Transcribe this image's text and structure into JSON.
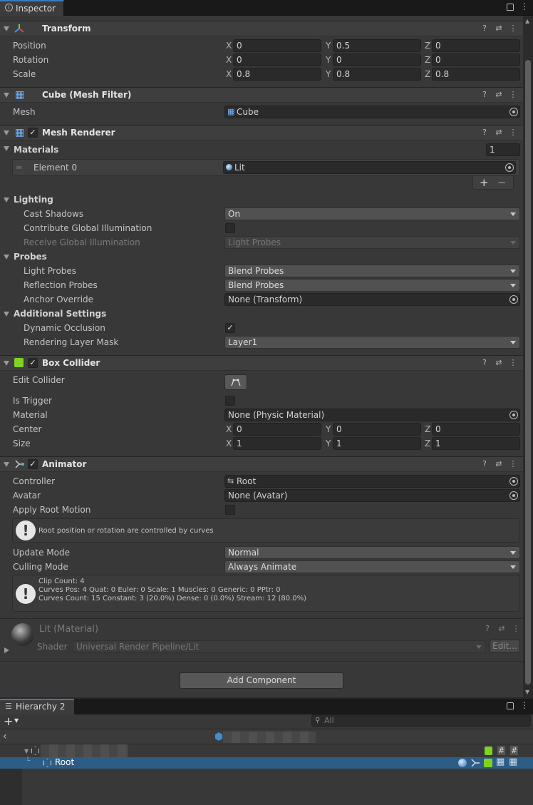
{
  "inspector_tab": {
    "title": "Inspector"
  },
  "transform": {
    "title": "Transform",
    "position": {
      "label": "Position",
      "x": "0",
      "y": "0.5",
      "z": "0"
    },
    "rotation": {
      "label": "Rotation",
      "x": "0",
      "y": "0",
      "z": "0"
    },
    "scale": {
      "label": "Scale",
      "x": "0.8",
      "y": "0.8",
      "z": "0.8"
    }
  },
  "axes": {
    "x": "X",
    "y": "Y",
    "z": "Z"
  },
  "mesh_filter": {
    "title": "Cube (Mesh Filter)",
    "mesh_label": "Mesh",
    "mesh_value": "Cube"
  },
  "mesh_renderer": {
    "title": "Mesh Renderer",
    "materials_label": "Materials",
    "materials_count": "1",
    "element0_label": "Element 0",
    "element0_value": "Lit",
    "add": "+",
    "remove": "−",
    "lighting_label": "Lighting",
    "cast_shadows_label": "Cast Shadows",
    "cast_shadows_value": "On",
    "contribute_gi_label": "Contribute Global Illumination",
    "receive_gi_label": "Receive Global Illumination",
    "receive_gi_value": "Light Probes",
    "probes_label": "Probes",
    "light_probes_label": "Light Probes",
    "light_probes_value": "Blend Probes",
    "reflection_probes_label": "Reflection Probes",
    "reflection_probes_value": "Blend Probes",
    "anchor_override_label": "Anchor Override",
    "anchor_override_value": "None (Transform)",
    "additional_label": "Additional Settings",
    "dynamic_occlusion_label": "Dynamic Occlusion",
    "rendering_layer_label": "Rendering Layer Mask",
    "rendering_layer_value": "Layer1"
  },
  "box_collider": {
    "title": "Box Collider",
    "edit_collider_label": "Edit Collider",
    "is_trigger_label": "Is Trigger",
    "material_label": "Material",
    "material_value": "None (Physic Material)",
    "center": {
      "label": "Center",
      "x": "0",
      "y": "0",
      "z": "0"
    },
    "size": {
      "label": "Size",
      "x": "1",
      "y": "1",
      "z": "1"
    }
  },
  "animator": {
    "title": "Animator",
    "controller_label": "Controller",
    "controller_value": "Root",
    "avatar_label": "Avatar",
    "avatar_value": "None (Avatar)",
    "apply_root_motion_label": "Apply Root Motion",
    "root_msg": "Root position or rotation are controlled by curves",
    "update_mode_label": "Update Mode",
    "update_mode_value": "Normal",
    "culling_mode_label": "Culling Mode",
    "culling_mode_value": "Always Animate",
    "clip_info_1": "Clip Count: 4",
    "clip_info_2": "Curves Pos: 4 Quat: 0 Euler: 0 Scale: 1 Muscles: 0 Generic: 0 PPtr: 0",
    "clip_info_3": "Curves Count: 15 Constant: 3 (20.0%) Dense: 0 (0.0%) Stream: 12 (80.0%)"
  },
  "material": {
    "title": "Lit (Material)",
    "shader_label": "Shader",
    "shader_value": "Universal Render Pipeline/Lit",
    "edit_label": "Edit..."
  },
  "add_component_label": "Add Component",
  "hierarchy": {
    "tab_title": "Hierarchy 2",
    "search_placeholder": "All",
    "root_item": "Root"
  },
  "colors": {
    "selection": "#2c5d87",
    "tab_accent": "#3a79bb",
    "collider_green": "#7ed321"
  }
}
